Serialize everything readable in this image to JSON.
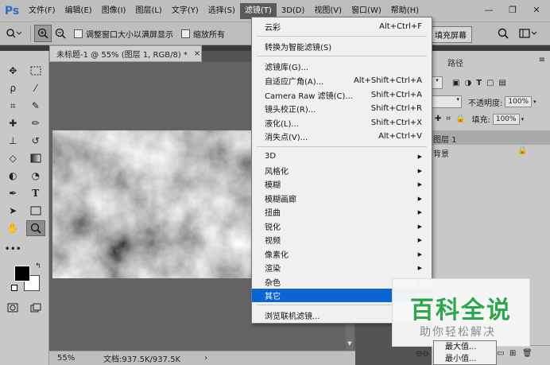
{
  "app": {
    "logo": "Ps"
  },
  "menubar": {
    "items": [
      "文件(F)",
      "编辑(E)",
      "图像(I)",
      "图层(L)",
      "文字(Y)",
      "选择(S)",
      "滤镜(T)",
      "3D(D)",
      "视图(V)",
      "窗口(W)",
      "帮助(H)"
    ],
    "active_index": 6
  },
  "options": {
    "resize_windows": "调整窗口大小以满屏显示",
    "zoom_all": "缩放所有",
    "fill_screen": "填充屏幕"
  },
  "document": {
    "tab_title": "未标题-1 @ 55% (图层 1, RGB/8) *",
    "close_glyph": "×",
    "zoom": "55%",
    "doc_info": "文档:937.5K/937.5K"
  },
  "right_panel": {
    "tab_paths": "路径",
    "opacity_label": "不透明度:",
    "opacity_value": "100%",
    "fill_label": "填充:",
    "fill_value": "100%",
    "layers": [
      "图层 1",
      "背景"
    ]
  },
  "filter_menu": {
    "items": [
      {
        "label": "云彩",
        "shortcut": "Alt+Ctrl+F"
      },
      {
        "label": "转换为智能滤镜(S)",
        "shortcut": ""
      },
      {
        "label": "滤镜库(G)...",
        "shortcut": ""
      },
      {
        "label": "自适应广角(A)...",
        "shortcut": "Alt+Shift+Ctrl+A"
      },
      {
        "label": "Camera Raw 滤镜(C)...",
        "shortcut": "Shift+Ctrl+A"
      },
      {
        "label": "镜头校正(R)...",
        "shortcut": "Shift+Ctrl+R"
      },
      {
        "label": "液化(L)...",
        "shortcut": "Shift+Ctrl+X"
      },
      {
        "label": "消失点(V)...",
        "shortcut": "Alt+Ctrl+V"
      },
      {
        "label": "3D",
        "submenu": true
      },
      {
        "label": "风格化",
        "submenu": true
      },
      {
        "label": "模糊",
        "submenu": true
      },
      {
        "label": "模糊画廊",
        "submenu": true
      },
      {
        "label": "扭曲",
        "submenu": true
      },
      {
        "label": "锐化",
        "submenu": true
      },
      {
        "label": "视频",
        "submenu": true
      },
      {
        "label": "像素化",
        "submenu": true
      },
      {
        "label": "渲染",
        "submenu": true
      },
      {
        "label": "杂色",
        "submenu": true
      },
      {
        "label": "其它",
        "submenu": true,
        "highlighted": true
      },
      {
        "label": "浏览联机滤镜...",
        "shortcut": ""
      }
    ]
  },
  "other_submenu": {
    "items": [
      "最大值...",
      "最小值..."
    ]
  },
  "watermark": {
    "title": "百科全说",
    "subtitle": "助你轻松解决"
  },
  "colors": {
    "highlight": "#0a64d2",
    "watermark_green": "#2aa548"
  }
}
